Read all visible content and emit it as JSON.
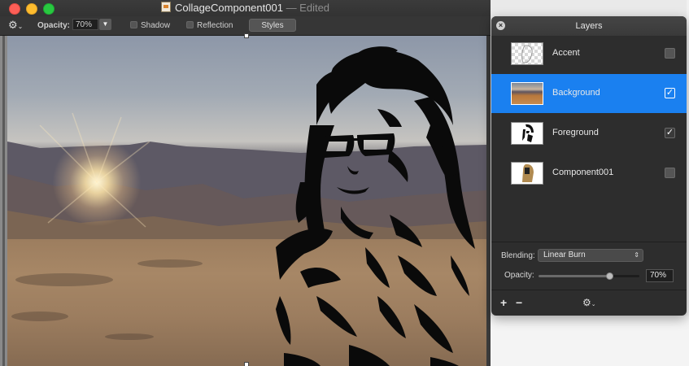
{
  "window": {
    "title": "CollageComponent001",
    "edited_suffix": "— Edited"
  },
  "toolbar": {
    "opacity_label": "Opacity:",
    "opacity_value": "70%",
    "shadow_label": "Shadow",
    "reflection_label": "Reflection",
    "styles_label": "Styles"
  },
  "layers_panel": {
    "title": "Layers",
    "layers": [
      {
        "name": "Accent",
        "visible": false,
        "selected": false
      },
      {
        "name": "Background",
        "visible": true,
        "selected": true
      },
      {
        "name": "Foreground",
        "visible": true,
        "selected": false
      },
      {
        "name": "Component001",
        "visible": false,
        "selected": false
      }
    ],
    "blending_label": "Blending:",
    "blending_value": "Linear Burn",
    "opacity_label": "Opacity:",
    "opacity_value": "70%",
    "opacity_fraction": 0.7,
    "add_label": "+",
    "remove_label": "−"
  },
  "colors": {
    "selection": "#1a80f0",
    "panel_bg": "#2d2d2d",
    "toolbar_bg": "#363636"
  }
}
